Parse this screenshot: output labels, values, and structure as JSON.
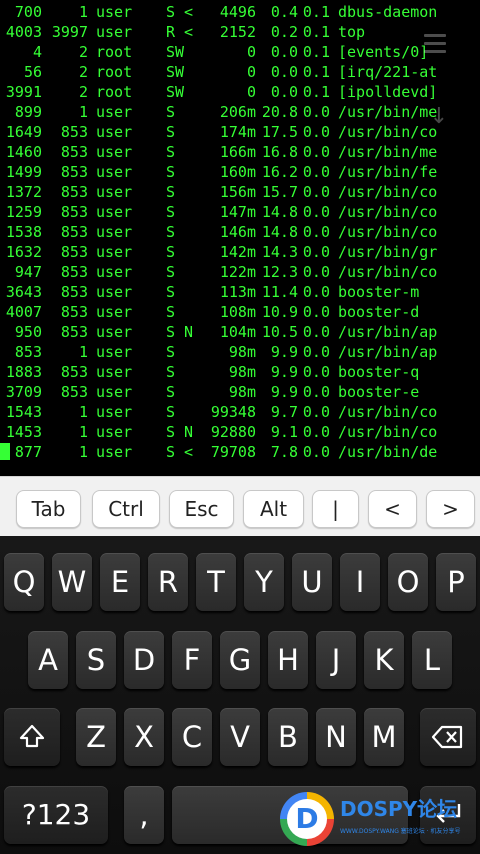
{
  "terminal": {
    "rows": [
      {
        "pid": "700",
        "ppid": "1",
        "user": "user",
        "stat": "S <",
        "vsz": "4496",
        "mem": "0.4",
        "cpu": "0.1",
        "cmd": "dbus-daemon"
      },
      {
        "pid": "4003",
        "ppid": "3997",
        "user": "user",
        "stat": "R <",
        "vsz": "2152",
        "mem": "0.2",
        "cpu": "0.1",
        "cmd": "top"
      },
      {
        "pid": "4",
        "ppid": "2",
        "user": "root",
        "stat": "SW",
        "vsz": "0",
        "mem": "0.0",
        "cpu": "0.1",
        "cmd": "[events/0]"
      },
      {
        "pid": "56",
        "ppid": "2",
        "user": "root",
        "stat": "SW",
        "vsz": "0",
        "mem": "0.0",
        "cpu": "0.1",
        "cmd": "[irq/221-at"
      },
      {
        "pid": "3991",
        "ppid": "2",
        "user": "root",
        "stat": "SW",
        "vsz": "0",
        "mem": "0.0",
        "cpu": "0.1",
        "cmd": "[ipolldevd]"
      },
      {
        "pid": "899",
        "ppid": "1",
        "user": "user",
        "stat": "S",
        "vsz": "206m",
        "mem": "20.8",
        "cpu": "0.0",
        "cmd": "/usr/bin/me"
      },
      {
        "pid": "1649",
        "ppid": "853",
        "user": "user",
        "stat": "S",
        "vsz": "174m",
        "mem": "17.5",
        "cpu": "0.0",
        "cmd": "/usr/bin/co"
      },
      {
        "pid": "1460",
        "ppid": "853",
        "user": "user",
        "stat": "S",
        "vsz": "166m",
        "mem": "16.8",
        "cpu": "0.0",
        "cmd": "/usr/bin/me"
      },
      {
        "pid": "1499",
        "ppid": "853",
        "user": "user",
        "stat": "S",
        "vsz": "160m",
        "mem": "16.2",
        "cpu": "0.0",
        "cmd": "/usr/bin/fe"
      },
      {
        "pid": "1372",
        "ppid": "853",
        "user": "user",
        "stat": "S",
        "vsz": "156m",
        "mem": "15.7",
        "cpu": "0.0",
        "cmd": "/usr/bin/co"
      },
      {
        "pid": "1259",
        "ppid": "853",
        "user": "user",
        "stat": "S",
        "vsz": "147m",
        "mem": "14.8",
        "cpu": "0.0",
        "cmd": "/usr/bin/co"
      },
      {
        "pid": "1538",
        "ppid": "853",
        "user": "user",
        "stat": "S",
        "vsz": "146m",
        "mem": "14.8",
        "cpu": "0.0",
        "cmd": "/usr/bin/co"
      },
      {
        "pid": "1632",
        "ppid": "853",
        "user": "user",
        "stat": "S",
        "vsz": "142m",
        "mem": "14.3",
        "cpu": "0.0",
        "cmd": "/usr/bin/gr"
      },
      {
        "pid": "947",
        "ppid": "853",
        "user": "user",
        "stat": "S",
        "vsz": "122m",
        "mem": "12.3",
        "cpu": "0.0",
        "cmd": "/usr/bin/co"
      },
      {
        "pid": "3643",
        "ppid": "853",
        "user": "user",
        "stat": "S",
        "vsz": "113m",
        "mem": "11.4",
        "cpu": "0.0",
        "cmd": "booster-m"
      },
      {
        "pid": "4007",
        "ppid": "853",
        "user": "user",
        "stat": "S",
        "vsz": "108m",
        "mem": "10.9",
        "cpu": "0.0",
        "cmd": "booster-d"
      },
      {
        "pid": "950",
        "ppid": "853",
        "user": "user",
        "stat": "S N",
        "vsz": "104m",
        "mem": "10.5",
        "cpu": "0.0",
        "cmd": "/usr/bin/ap"
      },
      {
        "pid": "853",
        "ppid": "1",
        "user": "user",
        "stat": "S",
        "vsz": "98m",
        "mem": "9.9",
        "cpu": "0.0",
        "cmd": "/usr/bin/ap"
      },
      {
        "pid": "1883",
        "ppid": "853",
        "user": "user",
        "stat": "S",
        "vsz": "98m",
        "mem": "9.9",
        "cpu": "0.0",
        "cmd": "booster-q"
      },
      {
        "pid": "3709",
        "ppid": "853",
        "user": "user",
        "stat": "S",
        "vsz": "98m",
        "mem": "9.9",
        "cpu": "0.0",
        "cmd": "booster-e"
      },
      {
        "pid": "1543",
        "ppid": "1",
        "user": "user",
        "stat": "S",
        "vsz": "99348",
        "mem": "9.7",
        "cpu": "0.0",
        "cmd": "/usr/bin/co"
      },
      {
        "pid": "1453",
        "ppid": "1",
        "user": "user",
        "stat": "S N",
        "vsz": "92880",
        "mem": "9.1",
        "cpu": "0.0",
        "cmd": "/usr/bin/co"
      },
      {
        "pid": "877",
        "ppid": "1",
        "user": "user",
        "stat": "S <",
        "vsz": "79708",
        "mem": "7.8",
        "cpu": "0.0",
        "cmd": "/usr/bin/de"
      }
    ]
  },
  "icons": {
    "menu": "menu-icon",
    "scroll_down": "arrow-down-icon"
  },
  "extra_keys": [
    "Tab",
    "Ctrl",
    "Esc",
    "Alt",
    "|",
    "<",
    ">"
  ],
  "keyboard": {
    "row1": [
      "Q",
      "W",
      "E",
      "R",
      "T",
      "Y",
      "U",
      "I",
      "O",
      "P"
    ],
    "row2": [
      "A",
      "S",
      "D",
      "F",
      "G",
      "H",
      "J",
      "K",
      "L"
    ],
    "row3": [
      "Z",
      "X",
      "C",
      "V",
      "B",
      "N",
      "M"
    ],
    "shift_icon": "shift-icon",
    "backspace_icon": "backspace-icon",
    "symbols_label": "?123",
    "comma_label": ",",
    "enter_icon": "enter-icon"
  },
  "watermark": {
    "logo_letter": "D",
    "brand": "DOSPY论坛",
    "sub": "WWW.DOSPY.WANG 塞班论坛 · 机友分享号"
  },
  "colors": {
    "terminal_text": "#35ff35",
    "terminal_bg": "#000000",
    "extra_bar_bg": "#f1f1f1",
    "key_bg": "#333333",
    "key_text": "#ffffff",
    "watermark_blue": "#2f86e8"
  }
}
